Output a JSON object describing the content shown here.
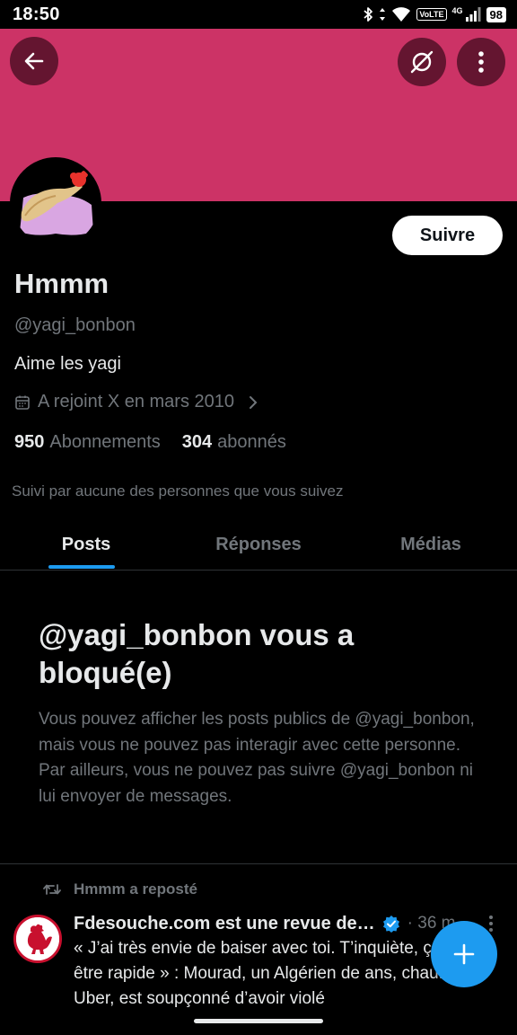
{
  "status_bar": {
    "time": "18:50",
    "network_label": "VoLTE",
    "signal_label": "4G",
    "battery": "98",
    "icons": [
      "bluetooth-icon",
      "data-arrows-icon",
      "wifi-icon",
      "signal-icon",
      "battery-icon"
    ]
  },
  "colors": {
    "banner": "#cc3366",
    "accent": "#1d9bf0",
    "background": "#000000",
    "primary_text": "#e7e9ea",
    "secondary_text": "#71767b"
  },
  "header": {
    "back_icon": "back-arrow-icon",
    "grok_icon": "grok-icon",
    "more_icon": "more-vertical-icon"
  },
  "profile": {
    "display_name": "Hmmm",
    "handle": "@yagi_bonbon",
    "bio": "Aime les yagi",
    "joined": "A rejoint X en mars 2010",
    "following_count": "950",
    "following_label": "Abonnements",
    "followers_count": "304",
    "followers_label": "abonnés",
    "followed_by": "Suivi par aucune des personnes que vous suivez",
    "follow_button": "Suivre"
  },
  "tabs": [
    {
      "label": "Posts",
      "active": true
    },
    {
      "label": "Réponses",
      "active": false
    },
    {
      "label": "Médias",
      "active": false
    }
  ],
  "blocked": {
    "title": "@yagi_bonbon vous a bloqué(e)",
    "body": "Vous pouvez afficher les posts publics de @yagi_bonbon, mais vous ne pouvez pas interagir avec cette personne. Par ailleurs, vous ne pouvez pas suivre @yagi_bonbon ni lui envoyer de messages."
  },
  "repost": {
    "label": "Hmmm a reposté",
    "author": "Fdesouche.com est une revue de…",
    "verified": true,
    "time": "· 36 m",
    "text": "« J’ai très envie de baiser avec toi. T’inquiète, ça va être rapide » : Mourad, un Algérien de ans, chauffeur Uber, est soupçonné d’avoir violé"
  }
}
